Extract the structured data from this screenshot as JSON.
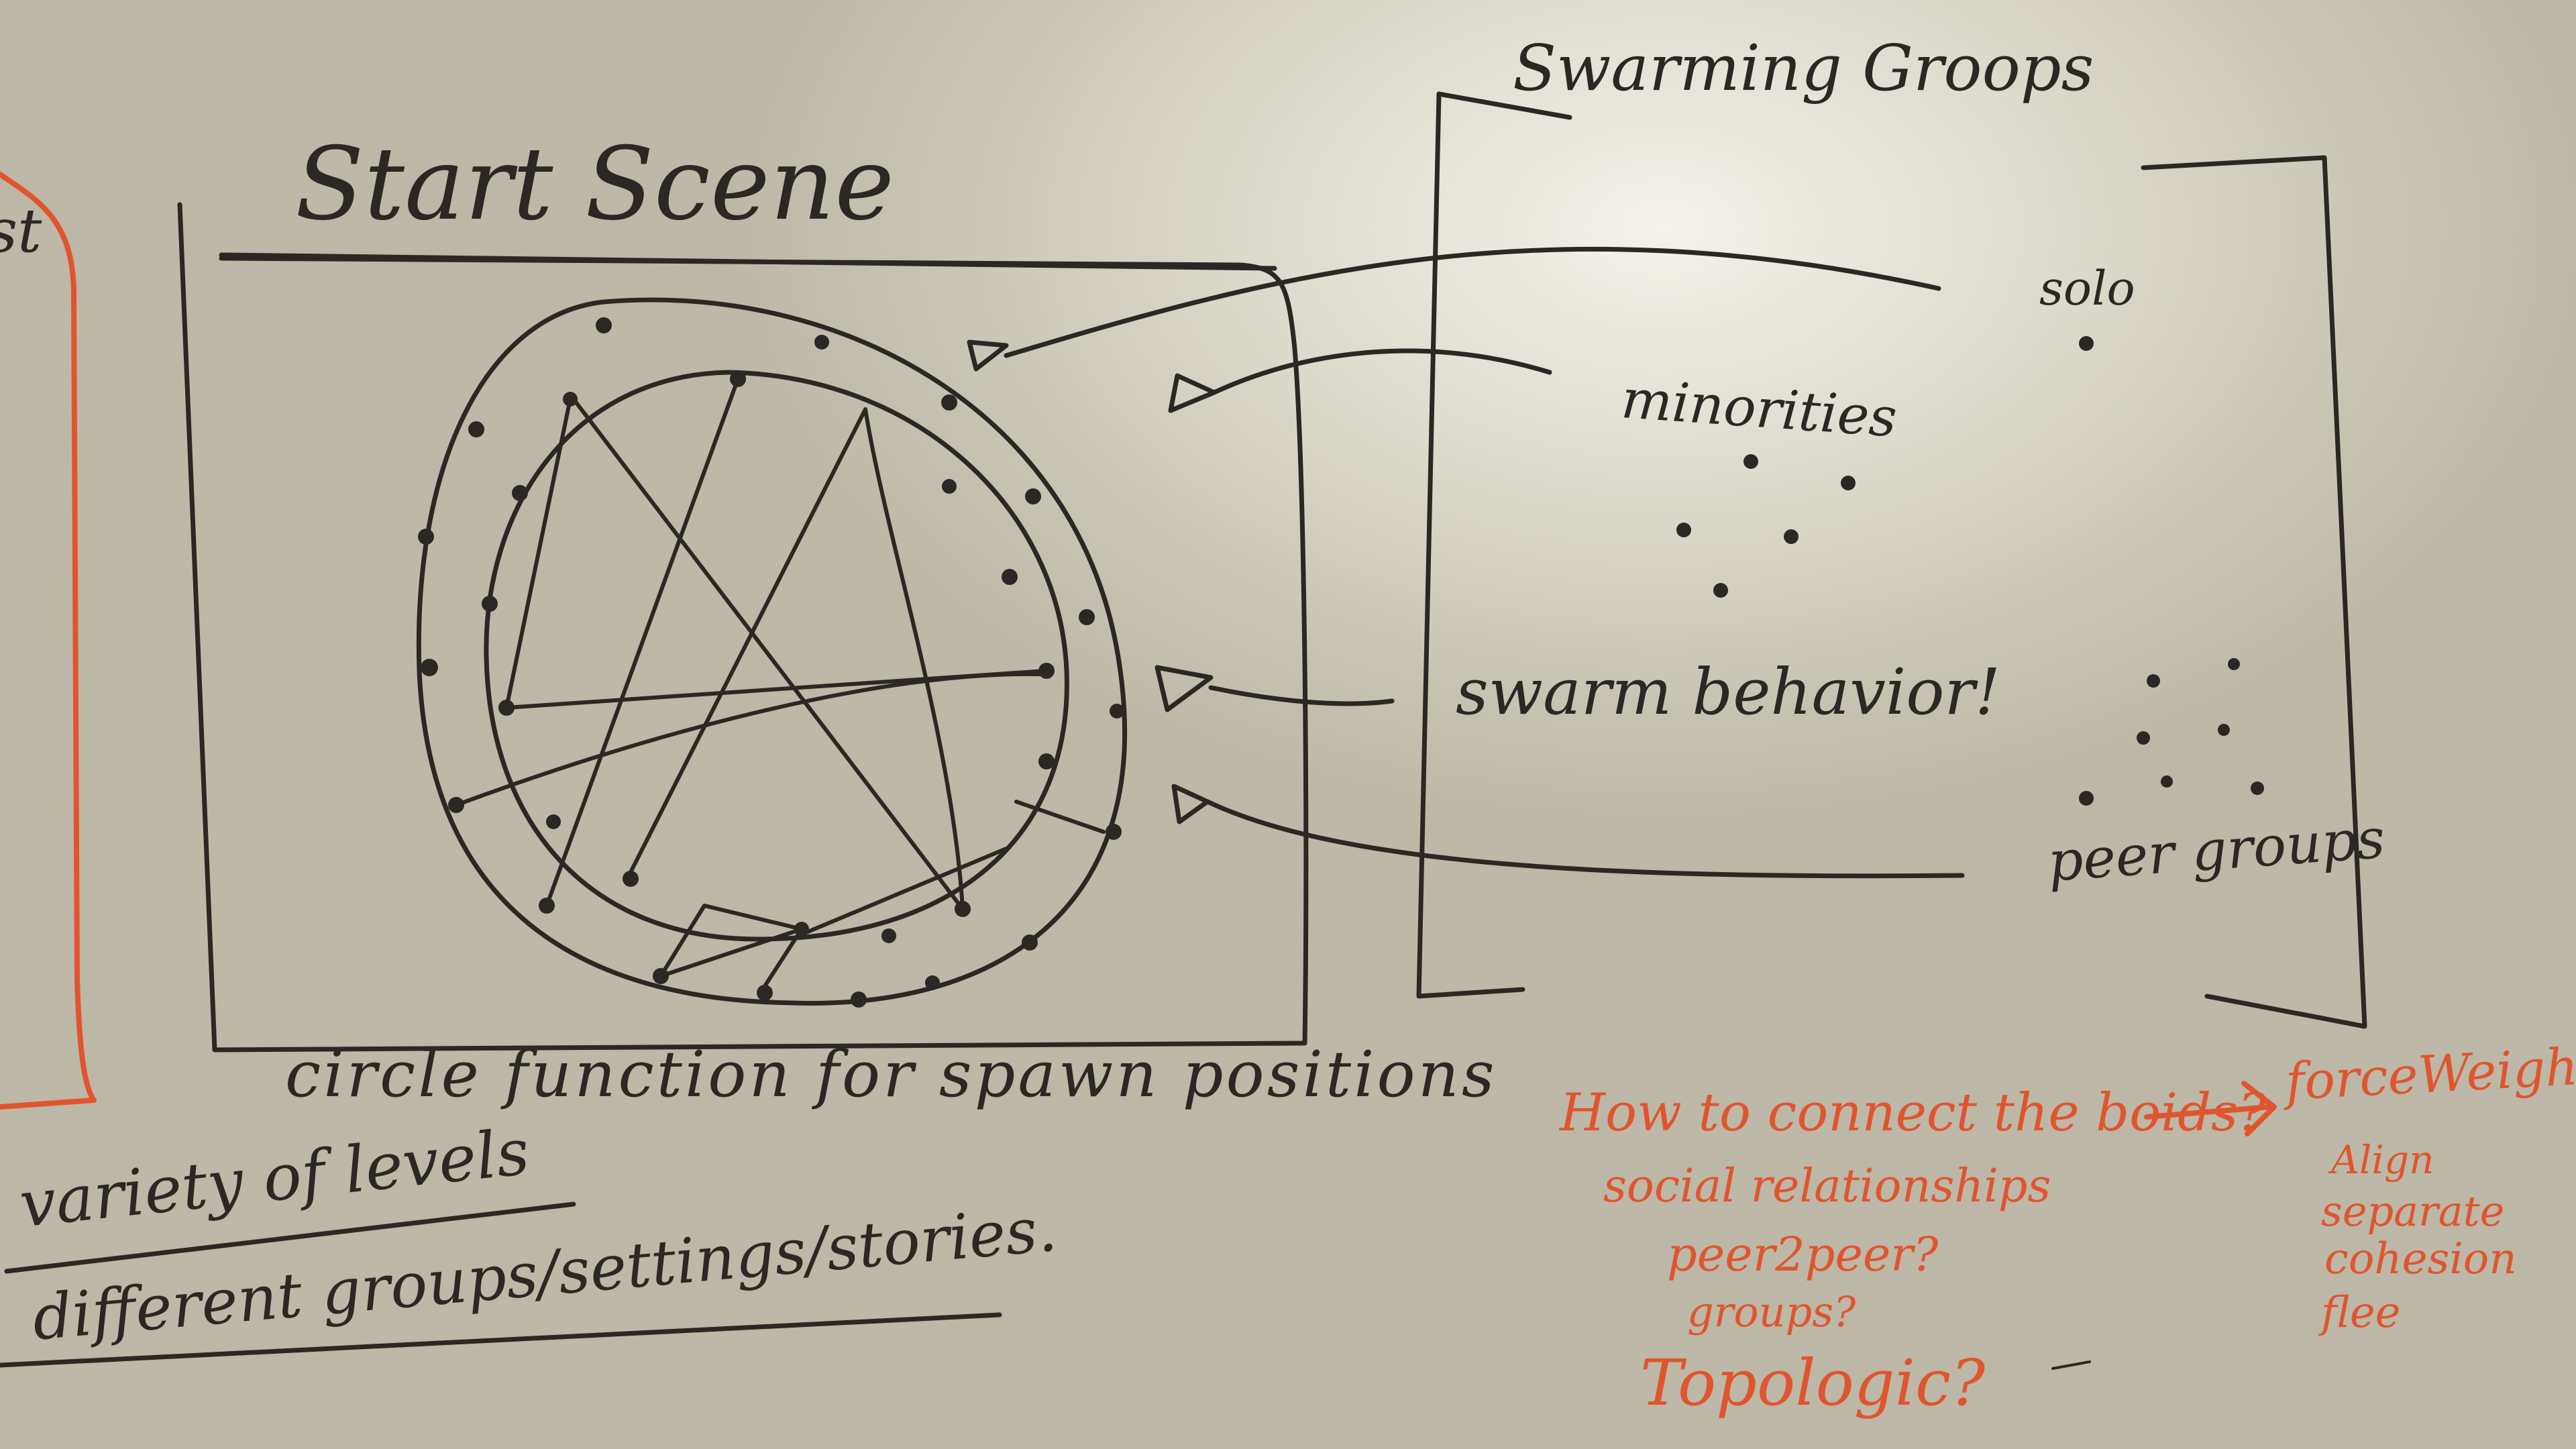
{
  "whiteboard": {
    "colors": {
      "marker_black": "#2a2724",
      "marker_red": "#e0552e",
      "board": "#dcd9cd"
    },
    "edge_fragment": "st",
    "start_scene": {
      "title": "Start Scene",
      "caption": "circle function for spawn positions"
    },
    "swarming_groups": {
      "title": "Swarming Groops",
      "labels": {
        "solo": "solo",
        "minorities": "minorities",
        "swarm": "swarm behavior!",
        "peer": "peer groups"
      }
    },
    "levels": {
      "line1": "variety of levels",
      "line2": "different groups/settings/stories."
    },
    "notes": {
      "question": "How to connect the boids?",
      "arrow_target": "forceWeights",
      "relationships": [
        "social relationships",
        "peer2peer?",
        "groups?",
        "Topologic?"
      ],
      "weights": [
        "Align",
        "separate",
        "cohesion",
        "flee"
      ]
    }
  }
}
